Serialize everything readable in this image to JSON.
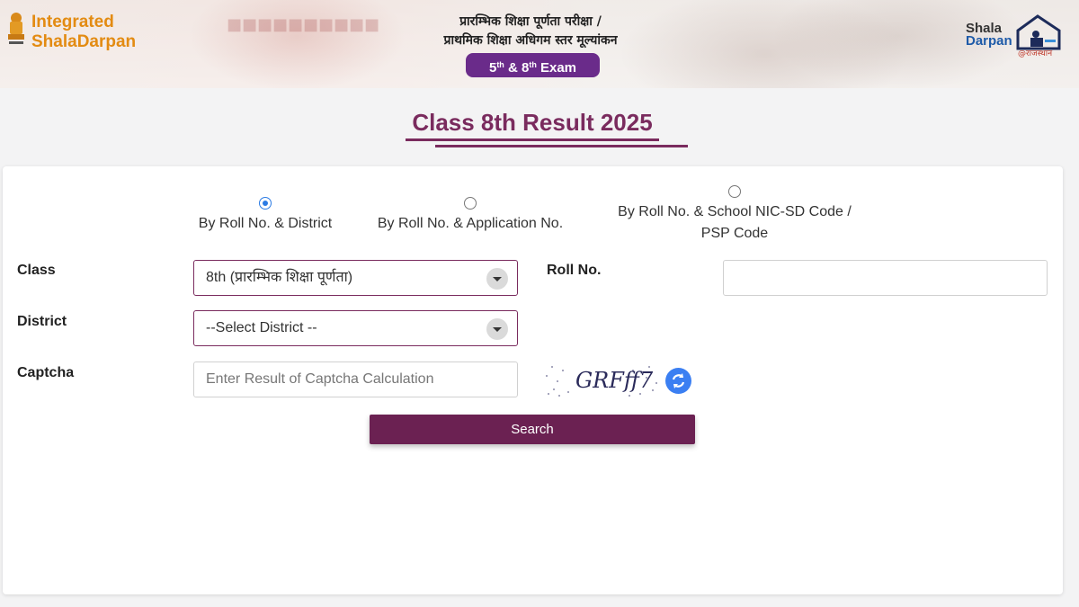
{
  "header": {
    "brand_top": "Integrated",
    "brand_bottom_1": "Shala",
    "brand_bottom_2": "Darpan",
    "exam_title_line1": "प्रारम्भिक शिक्षा पूर्णता परीक्षा /",
    "exam_title_line2": "प्राथमिक शिक्षा अधिगम स्तर मूल्यांकन",
    "exam_pill": {
      "a": "5",
      "a_sup": "th",
      "mid": " & 8",
      "b_sup": "th",
      "end": " Exam"
    },
    "right_logo_top": "Shala",
    "right_logo_bottom": "Darpan",
    "right_logo_tag": "@राजस्थान"
  },
  "page_title": "Class 8th Result 2025",
  "search_modes": [
    {
      "label": "By Roll No. & District",
      "selected": true
    },
    {
      "label": "By Roll No. & Application No.",
      "selected": false
    },
    {
      "label_line1": "By Roll No. & School NIC-SD Code /",
      "label_line2": "PSP Code",
      "selected": false
    }
  ],
  "form": {
    "class_label": "Class",
    "class_value": "8th (प्रारम्भिक शिक्षा पूर्णता)",
    "roll_label": "Roll No.",
    "roll_value": "",
    "district_label": "District",
    "district_value": "--Select District --",
    "captcha_label": "Captcha",
    "captcha_placeholder": "Enter Result of Captcha Calculation",
    "captcha_text": "GRFff7",
    "search_label": "Search"
  },
  "colors": {
    "accent": "#7a2b5e",
    "button": "#6b2152",
    "pill": "#6a2b8a",
    "radio": "#2b7be4",
    "refresh": "#3b7ff2",
    "brand_orange": "#e38b12"
  }
}
